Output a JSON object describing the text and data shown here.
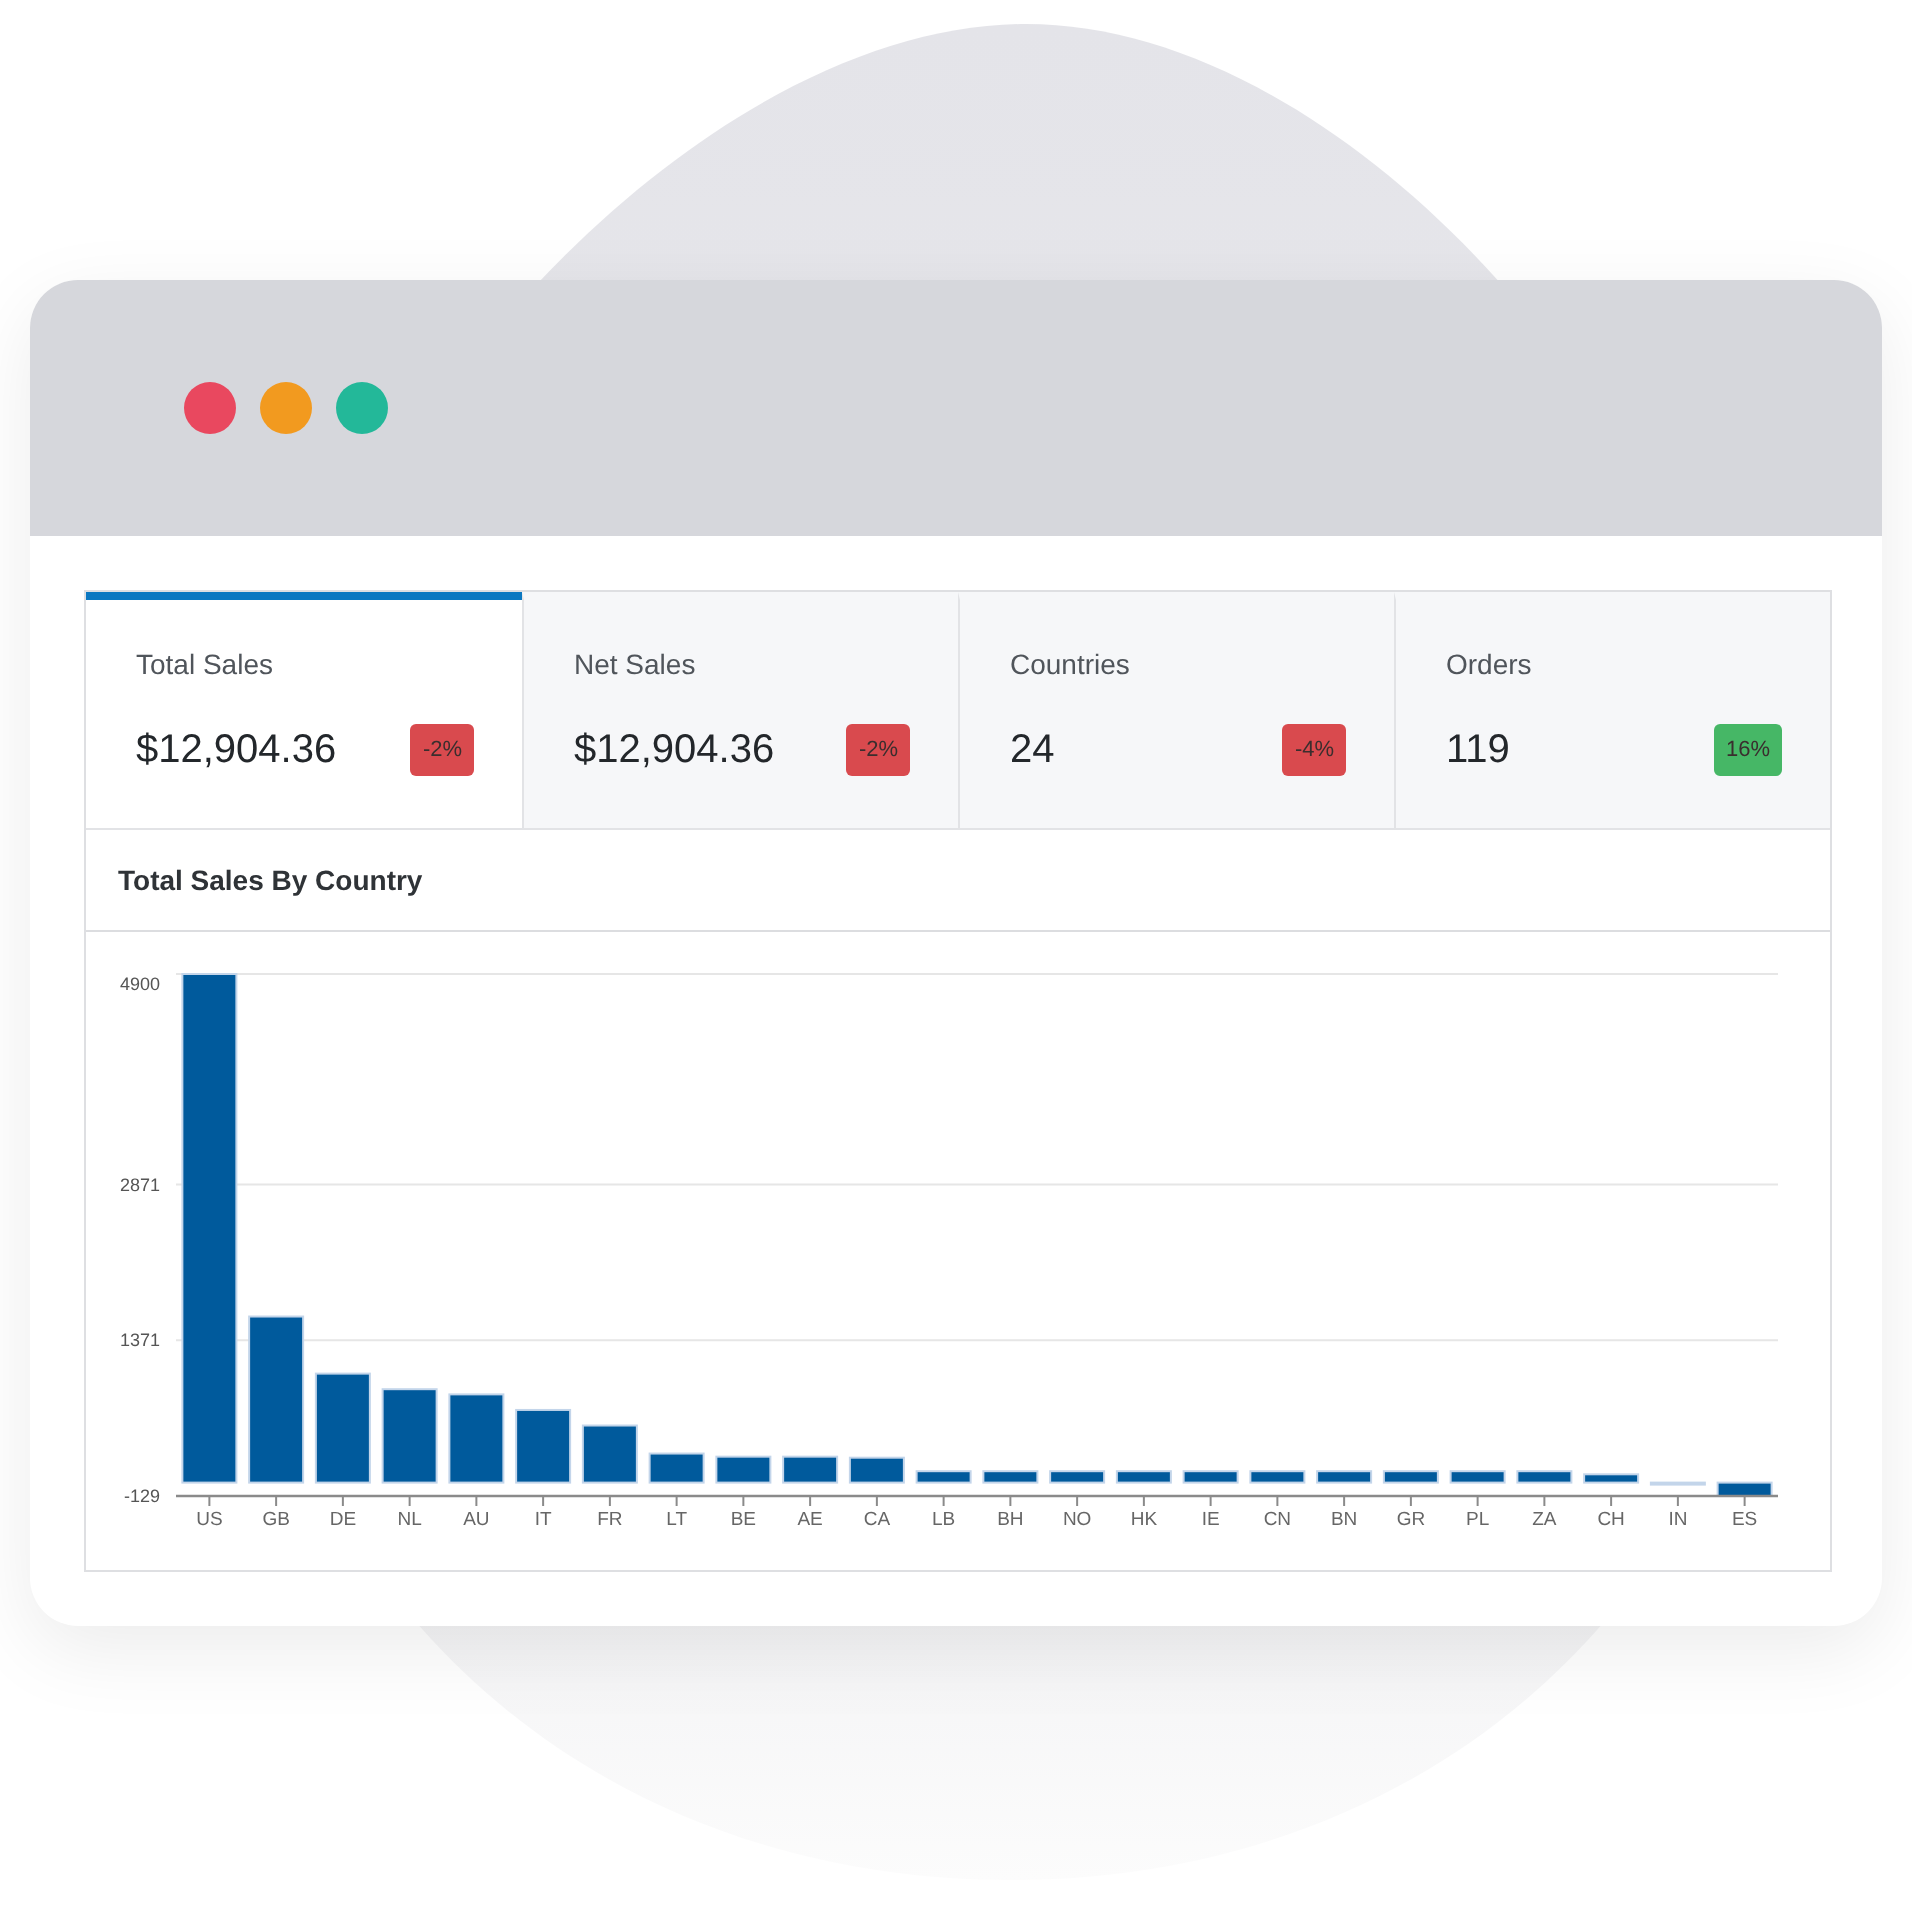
{
  "window": {
    "controls": [
      {
        "color": "#e9485f"
      },
      {
        "color": "#f29a1f"
      },
      {
        "color": "#23b899"
      }
    ]
  },
  "stat_cards": [
    {
      "label": "Total Sales",
      "value": "$12,904.36",
      "change": {
        "text": "-2%",
        "color": "#d94a4e"
      },
      "selected": true
    },
    {
      "label": "Net Sales",
      "value": "$12,904.36",
      "change": {
        "text": "-2%",
        "color": "#d94a4e"
      },
      "selected": false
    },
    {
      "label": "Countries",
      "value": "24",
      "change": {
        "text": "-4%",
        "color": "#d94a4e"
      },
      "selected": false
    },
    {
      "label": "Orders",
      "value": "119",
      "change": {
        "text": "16%",
        "color": "#46b766"
      },
      "selected": false
    }
  ],
  "chart_panel": {
    "title": "Total Sales By Country",
    "chart_data": {
      "type": "bar",
      "categories": [
        "US",
        "GB",
        "DE",
        "NL",
        "AU",
        "IT",
        "FR",
        "LT",
        "BE",
        "AE",
        "CA",
        "LB",
        "BH",
        "NO",
        "HK",
        "IE",
        "CN",
        "BN",
        "GR",
        "PL",
        "ZA",
        "CH",
        "IN",
        "ES"
      ],
      "values": [
        4900,
        1600,
        1050,
        900,
        850,
        700,
        550,
        280,
        250,
        250,
        240,
        110,
        110,
        110,
        110,
        110,
        110,
        110,
        110,
        110,
        110,
        80,
        0,
        -129
      ],
      "ylim": [
        -129,
        4900
      ],
      "yticks": [
        -129,
        1371,
        2871,
        4900
      ]
    }
  }
}
